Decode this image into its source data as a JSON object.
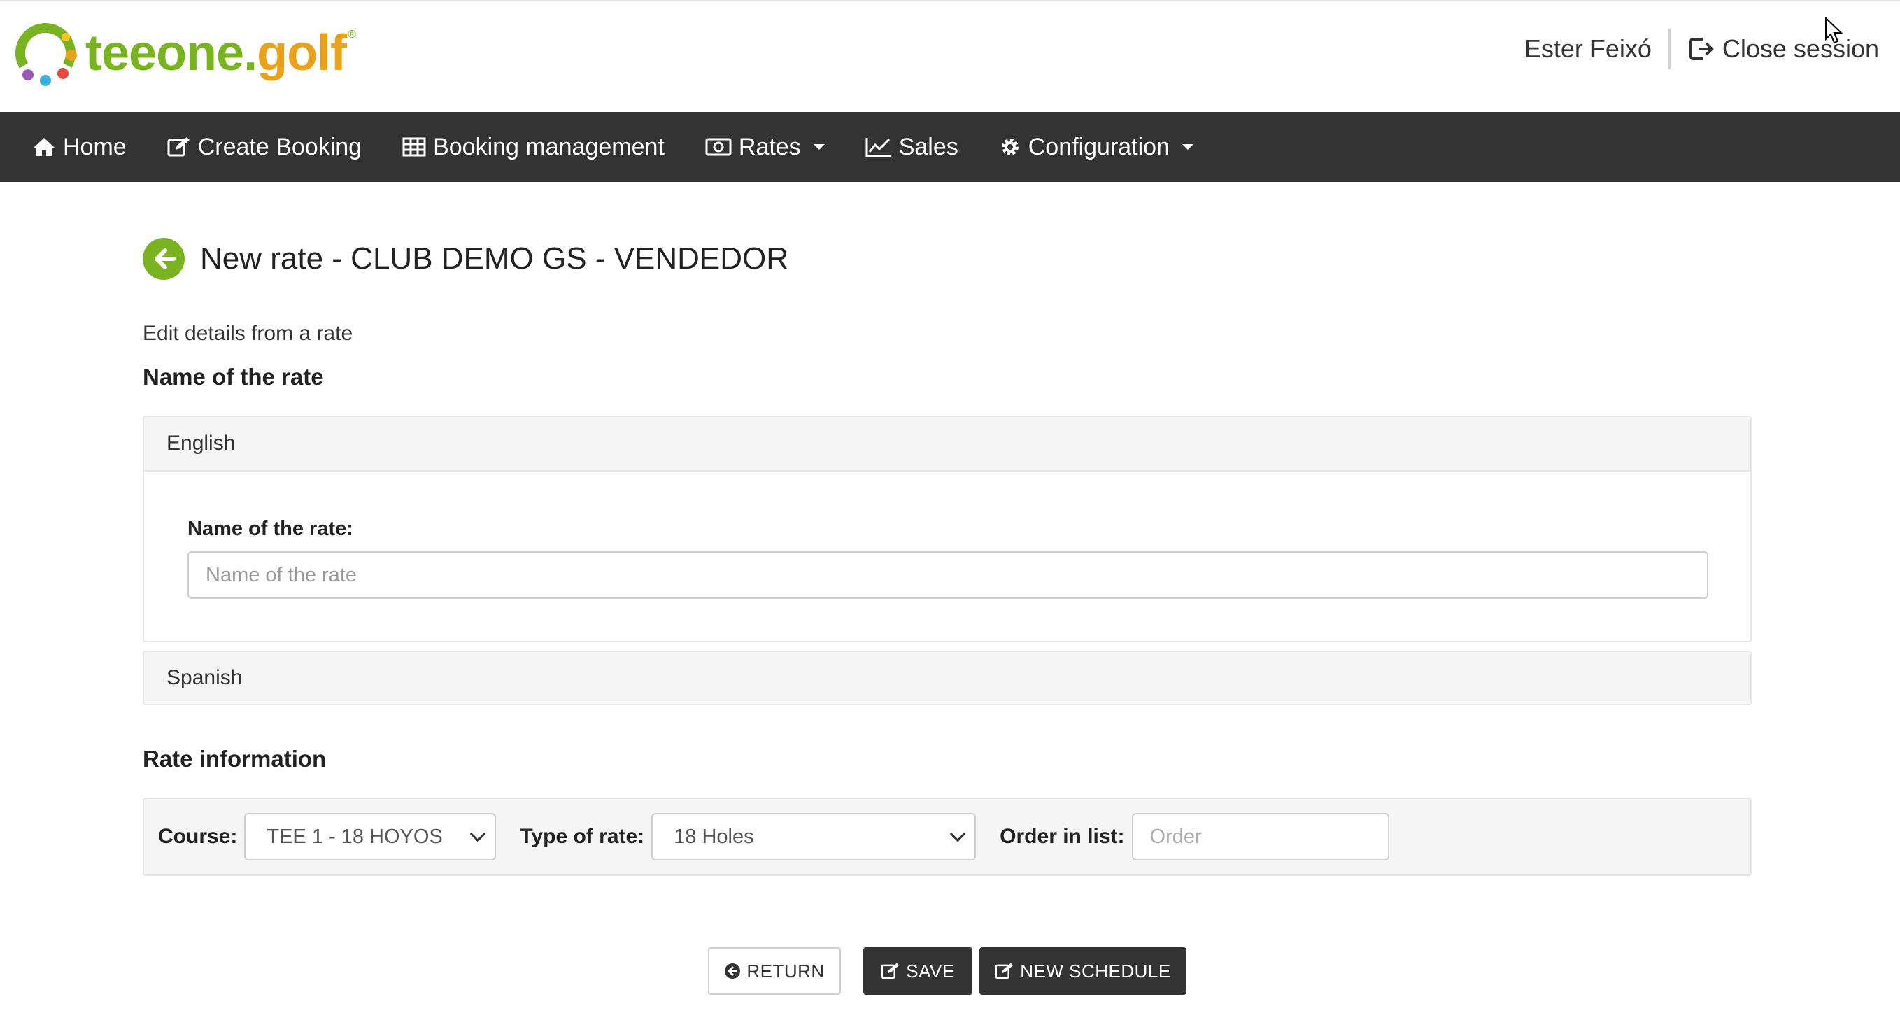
{
  "header": {
    "logo_text_tee": "tee",
    "logo_text_one": "one",
    "logo_text_dot": ".",
    "logo_text_golf": "golf",
    "logo_reg": "®",
    "user_name": "Ester Feixó",
    "close_session": "Close session"
  },
  "nav": {
    "items": [
      {
        "label": "Home",
        "icon": "home-icon"
      },
      {
        "label": "Create Booking",
        "icon": "edit-icon"
      },
      {
        "label": "Booking management",
        "icon": "table-icon"
      },
      {
        "label": "Rates",
        "icon": "money-icon",
        "dropdown": true
      },
      {
        "label": "Sales",
        "icon": "line-chart-icon"
      },
      {
        "label": "Configuration",
        "icon": "gear-icon",
        "dropdown": true
      }
    ]
  },
  "page": {
    "title": "New rate - CLUB DEMO GS - VENDEDOR",
    "subtitle": "Edit details from a rate",
    "name_section_title": "Name of the rate",
    "english_panel": {
      "heading": "English",
      "field_label": "Name of the rate:",
      "placeholder": "Name of the rate"
    },
    "spanish_panel": {
      "heading": "Spanish"
    },
    "rate_info_title": "Rate information",
    "rate_info": {
      "course_label": "Course:",
      "course_value": "TEE 1 - 18 HOYOS",
      "type_label": "Type of rate:",
      "type_value": "18 Holes",
      "order_label": "Order in list:",
      "order_placeholder": "Order"
    }
  },
  "buttons": {
    "return": "RETURN",
    "save": "SAVE",
    "new_schedule": "NEW SCHEDULE"
  },
  "colors": {
    "brand_green": "#7ab321",
    "brand_orange": "#e8a21c",
    "navbar_bg": "#333333"
  }
}
